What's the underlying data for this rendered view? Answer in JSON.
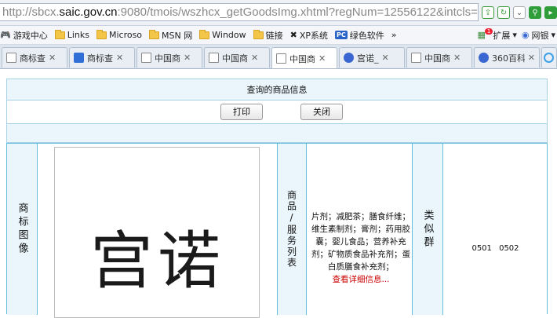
{
  "address_bar": {
    "url_prefix": "http://sbcx.",
    "url_host": "saic.gov.cn",
    "url_rest": ":9080/tmois/wszhcx_getGoodsImg.xhtml?regNum=12556122&intcls=5&s",
    "icons": [
      "share-icon",
      "refresh-icon",
      "dropdown-icon",
      "search-icon",
      "green-arrow-icon"
    ]
  },
  "bookmarks": {
    "items": [
      {
        "icon": "gamepad-icon",
        "label": "游戏中心"
      },
      {
        "icon": "folder-icon",
        "label": "Links"
      },
      {
        "icon": "folder-icon",
        "label": "Microso"
      },
      {
        "icon": "folder-icon",
        "label": "MSN 网"
      },
      {
        "icon": "folder-icon",
        "label": "Window"
      },
      {
        "icon": "folder-icon",
        "label": "链接"
      },
      {
        "icon": "xp-icon",
        "label": "XP系统"
      },
      {
        "icon": "pc-icon",
        "label": "绿色软件"
      }
    ],
    "more": "»",
    "extensions_label": "扩展",
    "extensions_badge": "1",
    "netbank_label": "网银"
  },
  "tabs": [
    {
      "icon": "doc",
      "label": "商标查"
    },
    {
      "icon": "blue",
      "label": "商标查"
    },
    {
      "icon": "doc",
      "label": "中国商"
    },
    {
      "icon": "doc",
      "label": "中国商"
    },
    {
      "icon": "doc",
      "label": "中国商",
      "active": true
    },
    {
      "icon": "paw",
      "label": "宫诺_"
    },
    {
      "icon": "doc",
      "label": "中国商"
    },
    {
      "icon": "paw",
      "label": "360百科"
    },
    {
      "icon": "ring",
      "label": ""
    }
  ],
  "page": {
    "caption": "查询的商品信息",
    "print_button": "打印",
    "close_button": "关闭",
    "trademark_header": "商标图像",
    "trademark_text": "宫诺",
    "goods_header": "商品/服务列表",
    "goods_text": "片剂；减肥茶；膳食纤维；维生素制剂；膏剂；药用胶囊；婴儿食品；营养补充剂；矿物质食品补充剂；蛋白质膳食补充剂；",
    "goods_more": "查看详细信息...",
    "similar_header": "类似群",
    "similar_groups": "0501 0502"
  }
}
